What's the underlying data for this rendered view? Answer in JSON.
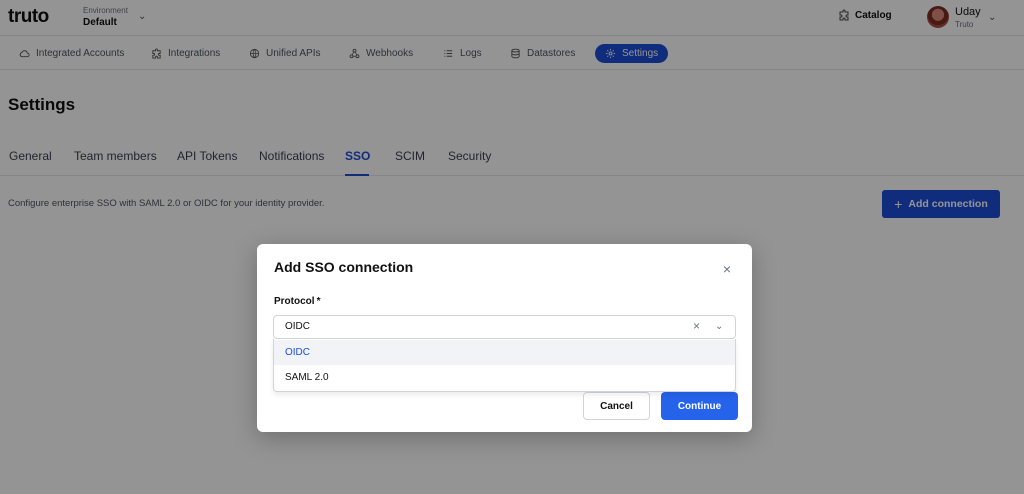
{
  "brand": {
    "logo": "truto"
  },
  "environment": {
    "label": "Environment",
    "value": "Default",
    "chevron_icon": "chevron-down-icon"
  },
  "header": {
    "catalog_label": "Catalog",
    "catalog_icon": "puzzle-icon",
    "user": {
      "name": "Uday",
      "org": "Truto"
    }
  },
  "nav": {
    "items": [
      {
        "label": "Integrated Accounts",
        "icon": "cloud-icon"
      },
      {
        "label": "Integrations",
        "icon": "puzzle-icon"
      },
      {
        "label": "Unified APIs",
        "icon": "globe-icon"
      },
      {
        "label": "Webhooks",
        "icon": "webhook-icon"
      },
      {
        "label": "Logs",
        "icon": "list-icon"
      },
      {
        "label": "Datastores",
        "icon": "database-icon"
      },
      {
        "label": "Settings",
        "icon": "gear-icon",
        "active": true
      }
    ]
  },
  "page": {
    "title": "Settings",
    "tabs": [
      "General",
      "Team members",
      "API Tokens",
      "Notifications",
      "SSO",
      "SCIM",
      "Security"
    ],
    "active_tab": "SSO",
    "description": "Configure enterprise SSO with SAML 2.0 or OIDC for your identity provider.",
    "add_button_label": "Add connection"
  },
  "modal": {
    "title": "Add SSO connection",
    "protocol_label": "Protocol",
    "required_mark": "*",
    "selected_value": "OIDC",
    "options": [
      "OIDC",
      "SAML 2.0"
    ],
    "cancel_label": "Cancel",
    "continue_label": "Continue"
  },
  "colors": {
    "accent": "#1d4ed8",
    "primary_button": "#2563eb",
    "overlay": "rgba(0,0,0,0.42)"
  }
}
